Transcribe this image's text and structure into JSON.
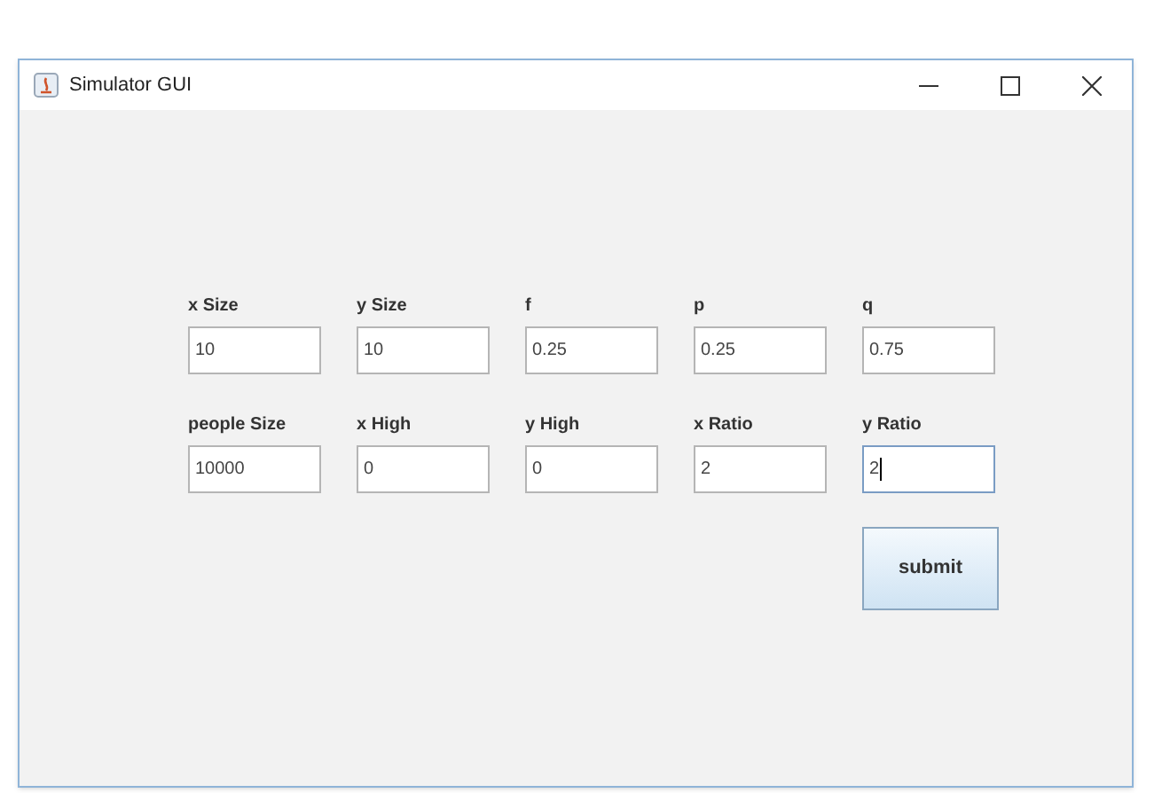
{
  "window": {
    "title": "Simulator GUI"
  },
  "fields": [
    {
      "label": "x Size",
      "value": "10",
      "focused": false
    },
    {
      "label": "y Size",
      "value": "10",
      "focused": false
    },
    {
      "label": "f",
      "value": "0.25",
      "focused": false
    },
    {
      "label": "p",
      "value": "0.25",
      "focused": false
    },
    {
      "label": "q",
      "value": "0.75",
      "focused": false
    },
    {
      "label": "people Size",
      "value": "10000",
      "focused": false
    },
    {
      "label": "x High",
      "value": "0",
      "focused": false
    },
    {
      "label": "y High",
      "value": "0",
      "focused": false
    },
    {
      "label": "x Ratio",
      "value": "2",
      "focused": false
    },
    {
      "label": "y Ratio",
      "value": "2",
      "focused": true
    }
  ],
  "buttons": [
    "submit"
  ]
}
